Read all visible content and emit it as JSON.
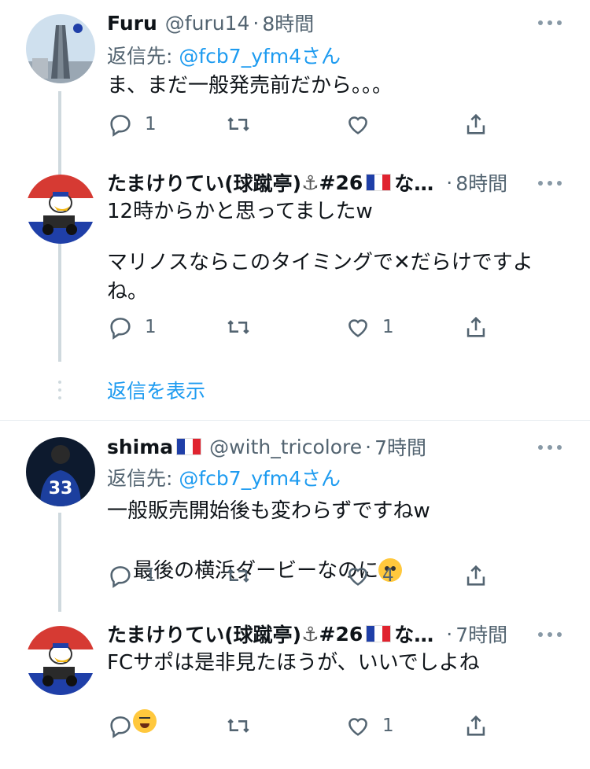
{
  "tweets": [
    {
      "name": "Furu",
      "handle": "@furu14",
      "dot": "·",
      "time": "8時間",
      "replying_prefix": "返信先: ",
      "replying_to": "@fcb7_yfm4さん",
      "text": "ま、まだ一般発売前だから。。。",
      "reply_count": "1",
      "retweet_count": "",
      "like_count": ""
    },
    {
      "name": "たまけりてい(球蹴亭)",
      "name_suffix": "#26",
      "name_tail": "な…",
      "dot": "·",
      "time": "8時間",
      "text_line1": "12時からかと思ってましたw",
      "text_line2": "マリノスならこのタイミングで✕だらけですよ",
      "text_line3": "ね。",
      "reply_count": "1",
      "retweet_count": "",
      "like_count": "1"
    },
    {
      "name": "shima",
      "handle": "@with_tricolore",
      "dot": "·",
      "time": "7時間",
      "replying_prefix": "返信先: ",
      "replying_to": "@fcb7_yfm4さん",
      "text_line1": "一般販売開始後も変わらずですねw",
      "text_line2": "最後の横浜ダービーなのに",
      "reply_count": "1",
      "retweet_count": "",
      "like_count": "4"
    },
    {
      "name": "たまけりてい(球蹴亭)",
      "name_suffix": "#26",
      "name_tail": "な…",
      "dot": "·",
      "time": "7時間",
      "text_line1": "FCサポは是非見たほうが、いいでしよね",
      "reply_count": "",
      "retweet_count": "",
      "like_count": "1"
    }
  ],
  "show_replies": "返信を表示",
  "icons": [
    "reply-icon",
    "retweet-icon",
    "like-icon",
    "share-icon",
    "more-icon",
    "anchor-icon",
    "france-flag-icon",
    "pleading-face-emoji",
    "laughing-face-emoji"
  ],
  "colors": {
    "link": "#1d9bf0",
    "secondary_text": "#536471",
    "thread_line": "#cfd9de"
  }
}
